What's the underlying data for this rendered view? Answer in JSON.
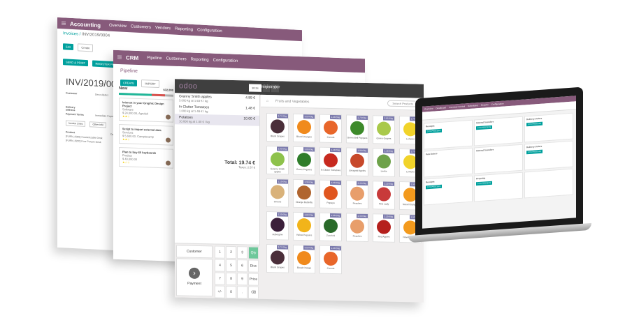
{
  "accounting": {
    "app": "Accounting",
    "menu": [
      "Overview",
      "Customers",
      "Vendors",
      "Reporting",
      "Configuration"
    ],
    "breadcrumb_root": "Invoices",
    "breadcrumb_current": "INV/2019/0004",
    "edit": "Edit",
    "create": "Create",
    "send_print": "SEND & PRINT",
    "register_payment": "REGISTER PAYMENT",
    "print_action": "Print",
    "action": "Action",
    "invoice_number": "INV/2019/0004",
    "customer_label": "Customer",
    "customer_value": "Deco Addict",
    "delivery_label": "Delivery address",
    "payment_terms_label": "Payment Terms",
    "payment_terms_value": "Immediate Payment",
    "tab_lines": "Invoice Lines",
    "tab_other": "Other Info",
    "col_product": "Product",
    "col_description": "Description",
    "line1": "[FURN_0096] Customizable Desk",
    "line2": "[FURN_8220] Four Person Desk"
  },
  "crm": {
    "app": "CRM",
    "menu": [
      "Pipeline",
      "Customers",
      "Reporting",
      "Configuration"
    ],
    "title": "Pipeline",
    "create": "CREATE",
    "import": "IMPORT",
    "column_name": "New",
    "column_total": "$32,800",
    "progress": {
      "green": 0.6,
      "red": 0.25
    },
    "cards": [
      {
        "title": "Interest in your Graphic Design Project",
        "tag": "Software",
        "amount": "$ 24,000.00, Agrolait",
        "stars": "★★☆"
      },
      {
        "title": "Script to import external data",
        "tag": "Services",
        "amount": "$ 5,600.00, Camptocamp",
        "stars": "★★☆"
      },
      {
        "title": "Plan to buy 60 keyboards",
        "tag": "Product",
        "amount": "$ 40,000.00",
        "stars": "★☆☆"
      }
    ]
  },
  "pos": {
    "logo": "odoo",
    "user": "Administrator",
    "order_tab": "10:31",
    "lines": [
      {
        "name": "Granny Smith apples",
        "detail": "3.000 kg at 1.63 € / kg",
        "price": "4.89 €",
        "selected": false
      },
      {
        "name": "In Clutter Tomatoes",
        "detail": "1.000 kg at 1.48 € / kg",
        "price": "1.48 €",
        "selected": false
      },
      {
        "name": "Potatoes",
        "detail": "10.000 kg at 1.00 € / kg",
        "price": "10.00 €",
        "selected": true
      }
    ],
    "total": "Total: 19.74 €",
    "taxes": "Taxes: 2.57 €",
    "customer": "Customer",
    "payment": "Payment",
    "keys": [
      "1",
      "2",
      "3",
      "Qty",
      "4",
      "5",
      "6",
      "Disc",
      "7",
      "8",
      "9",
      "Price",
      "+/-",
      "0",
      ".",
      "⌫"
    ],
    "category": "Fruits and Vegetables",
    "search_placeholder": "Search Products",
    "products": [
      {
        "name": "Black Grapes",
        "price": "3.77 €/kg",
        "color": "#4b2f3a"
      },
      {
        "name": "Blood Oranges",
        "price": "3.50 €/kg",
        "color": "#f08a1c"
      },
      {
        "name": "Carrots",
        "price": "1.20 €/kg",
        "color": "#e8662a"
      },
      {
        "name": "Green Bell Peppers",
        "price": "2.70 €/kg",
        "color": "#3d8a2a"
      },
      {
        "name": "Green Grapes",
        "price": "2.85 €/kg",
        "color": "#a9c94a"
      },
      {
        "name": "Lemons",
        "price": "1.70 €/kg",
        "color": "#f1d32a"
      },
      {
        "name": "Granny Smith apples",
        "price": "1.63 €/kg",
        "color": "#8ec24c"
      },
      {
        "name": "Green Peppers",
        "price": "3.00 €/kg",
        "color": "#2f7d2a"
      },
      {
        "name": "In Clutter Tomatoes",
        "price": "1.48 €/kg",
        "color": "#c72a1f"
      },
      {
        "name": "Jonagold Apples",
        "price": "1.98 €/kg",
        "color": "#c7482a"
      },
      {
        "name": "Leeks",
        "price": "1.40 €/kg",
        "color": "#6ea24a"
      },
      {
        "name": "Lemons",
        "price": "1.70 €/kg",
        "color": "#f1d32a"
      },
      {
        "name": "Onions",
        "price": "1.10 €/kg",
        "color": "#d9b27a"
      },
      {
        "name": "Orange Butterfly",
        "price": "2.30 €/kg",
        "color": "#b0652f"
      },
      {
        "name": "Papaya",
        "price": "3.50 €/kg",
        "color": "#e0561f"
      },
      {
        "name": "Peaches",
        "price": "2.40 €/kg",
        "color": "#e89e6b"
      },
      {
        "name": "Pink Lady",
        "price": "2.10 €/kg",
        "color": "#c83a3a"
      },
      {
        "name": "Navel Oranges",
        "price": "1.90 €/kg",
        "color": "#f39a1d"
      },
      {
        "name": "Aubergine",
        "price": "2.50 €/kg",
        "color": "#3b1f3a"
      },
      {
        "name": "Yellow Peppers",
        "price": "2.80 €/kg",
        "color": "#f2b41a"
      },
      {
        "name": "Zucchini",
        "price": "1.60 €/kg",
        "color": "#2a6a2a"
      },
      {
        "name": "Peaches",
        "price": "2.40 €/kg",
        "color": "#e89e6b"
      },
      {
        "name": "Red Apples",
        "price": "2.20 €/kg",
        "color": "#b5201d"
      },
      {
        "name": "Navel oranges",
        "price": "1.90 €/kg",
        "color": "#f39a1d"
      },
      {
        "name": "Black Grapes",
        "price": "3.77 €/kg",
        "color": "#4b2f3a"
      },
      {
        "name": "Blood Orange",
        "price": "3.50 €/kg",
        "color": "#f08a1c"
      },
      {
        "name": "Carrots",
        "price": "1.20 €/kg",
        "color": "#e8662a"
      }
    ]
  },
  "laptop": {
    "app_menu": [
      "Overview",
      "Dashboard",
      "Inventory Control",
      "Schedulers",
      "Reports",
      "Configuration"
    ],
    "cards": [
      {
        "name": "Receipts",
        "btn": "3 TO PROCESS"
      },
      {
        "name": "Internal Transfers",
        "btn": "3 TO PROCESS"
      },
      {
        "name": "Delivery Orders",
        "btn": "3 TO PROCESS"
      },
      {
        "name": "PoS Orders",
        "btn": ""
      },
      {
        "name": "Internal Transfers",
        "btn": ""
      },
      {
        "name": "Delivery Orders",
        "btn": "3 TO PROCESS"
      },
      {
        "name": "Receipts",
        "btn": "3 TO PROCESS"
      },
      {
        "name": "Dropship",
        "btn": "3 TO PROCESS"
      },
      {
        "name": "",
        "btn": ""
      }
    ]
  }
}
